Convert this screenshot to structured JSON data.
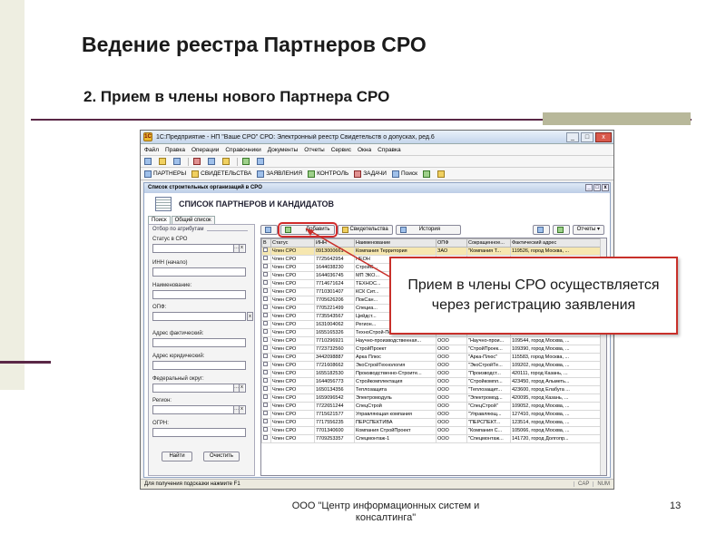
{
  "slide": {
    "title": "Ведение реестра Партнеров СРО",
    "subtitle": "2. Прием в члены нового Партнера СРО",
    "footer": "ООО \"Центр информационных систем и консалтинга\"",
    "page_number": "13",
    "callout": "Прием в члены СРО осуществляется через регистрацию заявления",
    "accent_color": "#5a2746",
    "callout_border_color": "#c8302a"
  },
  "window": {
    "title": "1С:Предприятие - НП \"Ваше СРО\" СРО: Электронный реестр Свидетельств о допусках, ред.6",
    "app_icon": "1С",
    "controls": [
      "_",
      "□",
      "x"
    ],
    "menu": [
      "Файл",
      "Правка",
      "Операции",
      "Справочники",
      "Документы",
      "Отчеты",
      "Сервис",
      "Окна",
      "Справка"
    ],
    "toolbar1": [
      "",
      "",
      "",
      "",
      "",
      "",
      "",
      "",
      ""
    ],
    "toolbar2": [
      "ПАРТНЕРЫ",
      "СВИДЕТЕЛЬСТВА",
      "ЗАЯВЛЕНИЯ",
      "КОНТРОЛЬ",
      "ЗАДАЧИ",
      "Поиск"
    ],
    "status_hint": "Для получения подсказки нажмите F1",
    "status_cap": "CAP",
    "status_num": "NUM"
  },
  "list": {
    "window_title": "Список строительных организаций в СРО",
    "header": "СПИСОК ПАРТНЕРОВ И КАНДИДАТОВ",
    "tabs": [
      "Поиск",
      "Общий список"
    ],
    "filter": {
      "group_title": "Отбор по атрибутам",
      "status_label": "Статус в СРО",
      "inn_label": "ИНН (начало)",
      "name_label": "Наименование:",
      "opf_label": "ОПФ:",
      "addr_fact_label": "Адрес фактический:",
      "addr_legal_label": "Адрес юридический:",
      "fed_district_label": "Федеральный округ:",
      "region_label": "Регион:",
      "ogrn_label": "ОГРН:",
      "find_button": "Найти",
      "clear_button": "Очистить"
    },
    "grid_toolbar": {
      "add": "Добавить",
      "certificates": "Свидетельства",
      "history": "История",
      "actions": "Отчеты"
    },
    "columns": [
      "В",
      "Статус",
      "ИНН",
      "Наименование",
      "ОПФ",
      "Сокращенное...",
      "Фактический адрес"
    ],
    "rows": [
      {
        "status": "Член СРО",
        "inn": "0913000661",
        "name": "Компания Территория",
        "opf": "ЗАО",
        "short": "\"Компания Т...",
        "addr": "119526, город Москва, ..."
      },
      {
        "status": "Член СРО",
        "inn": "7725642954",
        "name": "НЕОН",
        "opf": "",
        "short": "",
        "addr": ""
      },
      {
        "status": "Член СРО",
        "inn": "1644038230",
        "name": "СтройС...",
        "opf": "",
        "short": "",
        "addr": ""
      },
      {
        "status": "Член СРО",
        "inn": "1644036745",
        "name": "МП ЭКО...",
        "opf": "",
        "short": "",
        "addr": ""
      },
      {
        "status": "Член СРО",
        "inn": "7714671624",
        "name": "ТЕХНОС...",
        "opf": "",
        "short": "",
        "addr": ""
      },
      {
        "status": "Член СРО",
        "inn": "7710301407",
        "name": "КСК Сит...",
        "opf": "",
        "short": "",
        "addr": ""
      },
      {
        "status": "Член СРО",
        "inn": "7705626206",
        "name": "ПокСан...",
        "opf": "",
        "short": "",
        "addr": ""
      },
      {
        "status": "Член СРО",
        "inn": "7705221499",
        "name": "Специа...",
        "opf": "",
        "short": "",
        "addr": ""
      },
      {
        "status": "Член СРО",
        "inn": "7735543567",
        "name": "Цейдст...",
        "opf": "",
        "short": "",
        "addr": ""
      },
      {
        "status": "Член СРО",
        "inn": "1631004062",
        "name": "Регион...",
        "opf": "",
        "short": "",
        "addr": ""
      },
      {
        "status": "Член СРО",
        "inn": "1655165326",
        "name": "ТехноСтрой-Поволжье",
        "opf": "ООО",
        "short": "\"ТехноСтрой...",
        "addr": "420107, город Казань, ..."
      },
      {
        "status": "Член СРО",
        "inn": "7710296921",
        "name": "Научно-производственная...",
        "opf": "ООО",
        "short": "\"Научно-прои...",
        "addr": "109544, город Москва, ..."
      },
      {
        "status": "Член СРО",
        "inn": "7723732560",
        "name": "СтройПроект",
        "opf": "ООО",
        "short": "\"СтройПроек...",
        "addr": "109390, город Москва, ..."
      },
      {
        "status": "Член СРО",
        "inn": "3442098887",
        "name": "Арка Плюс",
        "opf": "ООО",
        "short": "\"Арка-Плюс\"",
        "addr": "115583, город Москва, ..."
      },
      {
        "status": "Член СРО",
        "inn": "7721608662",
        "name": "ЭкоСтройТехнология",
        "opf": "ООО",
        "short": "\"ЭкоСтройТе...",
        "addr": "109202, город Москва, ..."
      },
      {
        "status": "Член СРО",
        "inn": "1655182530",
        "name": "Производственно-Строите...",
        "opf": "ООО",
        "short": "\"Производст...",
        "addr": "420111, город Казань, ..."
      },
      {
        "status": "Член СРО",
        "inn": "1644056773",
        "name": "Стройкомплектация",
        "opf": "ООО",
        "short": "\"Стройкомпл...",
        "addr": "423450, город Альметь..."
      },
      {
        "status": "Член СРО",
        "inn": "1650134356",
        "name": "Теплозащита",
        "opf": "ООО",
        "short": "\"Теплозащит...",
        "addr": "423600, город Елабуга ..."
      },
      {
        "status": "Член СРО",
        "inn": "1659096542",
        "name": "Электромодуль",
        "opf": "ООО",
        "short": "\"Электромод...",
        "addr": "420095, город Казань, ..."
      },
      {
        "status": "Член СРО",
        "inn": "7722651244",
        "name": "СпецСтрой",
        "opf": "ООО",
        "short": "\"СпецСтрой\"",
        "addr": "109052, город Москва, ..."
      },
      {
        "status": "Член СРО",
        "inn": "7715621577",
        "name": "Управляющая компания",
        "opf": "ООО",
        "short": "\"Управляющ...",
        "addr": "127410, город Москва, ..."
      },
      {
        "status": "Член СРО",
        "inn": "7717556235",
        "name": "ПЕРСПЕКТИВА",
        "opf": "ООО",
        "short": "\"ПЕРСПЕКТ...",
        "addr": "123514, город Москва, ..."
      },
      {
        "status": "Член СРО",
        "inn": "7701340600",
        "name": "Компания СтройПроект",
        "opf": "ООО",
        "short": "\"Компания С...",
        "addr": "105066, город Москва, ..."
      },
      {
        "status": "Член СРО",
        "inn": "7709253357",
        "name": "Спецмонтаж-1",
        "opf": "ООО",
        "short": "\"Спецмонтаж...",
        "addr": "141720, город Долгопр..."
      }
    ]
  }
}
